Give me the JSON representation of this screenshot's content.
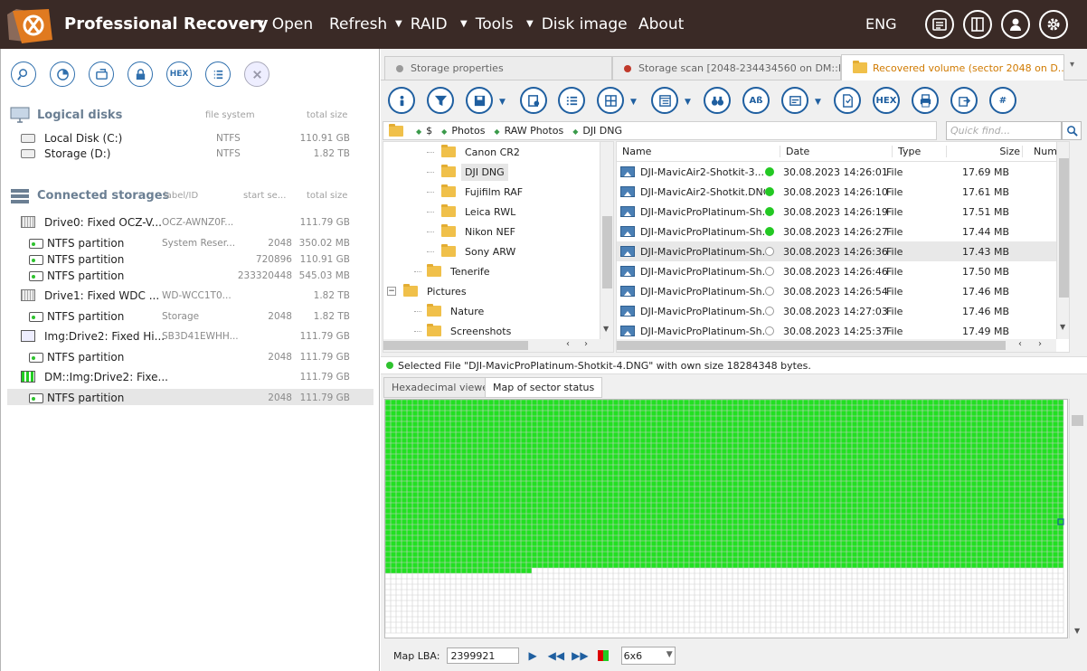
{
  "app": {
    "title": "Professional Recovery",
    "lang": "ENG"
  },
  "menu": [
    {
      "label": "Open",
      "dropdown": true
    },
    {
      "label": "Refresh",
      "dropdown": false
    },
    {
      "label": "RAID",
      "dropdown": true
    },
    {
      "label": "Tools",
      "dropdown": true
    },
    {
      "label": "Disk image",
      "dropdown": true
    },
    {
      "label": "About",
      "dropdown": false
    }
  ],
  "left_toolbar": {
    "hex_label": "HEX"
  },
  "logical": {
    "title": "Logical disks",
    "col_fs": "file system",
    "col_size": "total size",
    "items": [
      {
        "name": "Local Disk (C:)",
        "fs": "NTFS",
        "size": "110.91 GB"
      },
      {
        "name": "Storage (D:)",
        "fs": "NTFS",
        "size": "1.82 TB"
      }
    ]
  },
  "connected": {
    "title": "Connected storages",
    "col_label": "label/ID",
    "col_start": "start se...",
    "col_size": "total size",
    "items": [
      {
        "name": "Drive0: Fixed OCZ-V...",
        "label": "OCZ-AWNZ0F...",
        "start": "",
        "size": "111.79 GB",
        "kind": "drive"
      },
      {
        "name": "NTFS partition",
        "label": "System Reser...",
        "start": "2048",
        "size": "350.02 MB",
        "kind": "part"
      },
      {
        "name": "NTFS partition",
        "label": "",
        "start": "720896",
        "size": "110.91 GB",
        "kind": "part"
      },
      {
        "name": "NTFS partition",
        "label": "",
        "start": "233320448",
        "size": "545.03 MB",
        "kind": "part"
      },
      {
        "name": "Drive1: Fixed WDC ...",
        "label": "WD-WCC1T0...",
        "start": "",
        "size": "1.82 TB",
        "kind": "drive"
      },
      {
        "name": "NTFS partition",
        "label": "Storage",
        "start": "2048",
        "size": "1.82 TB",
        "kind": "part"
      },
      {
        "name": "Img:Drive2: Fixed Hi...",
        "label": "SB3D41EWHH...",
        "start": "",
        "size": "111.79 GB",
        "kind": "img"
      },
      {
        "name": "NTFS partition",
        "label": "",
        "start": "2048",
        "size": "111.79 GB",
        "kind": "part"
      },
      {
        "name": "DM::Img:Drive2: Fixe...",
        "label": "",
        "start": "",
        "size": "111.79 GB",
        "kind": "dm"
      },
      {
        "name": "NTFS partition",
        "label": "",
        "start": "2048",
        "size": "111.79 GB",
        "kind": "part",
        "selected": true
      }
    ]
  },
  "tabs": [
    {
      "label": "Storage properties",
      "dot": "#9a9a9a"
    },
    {
      "label": "Storage scan [2048-234434560 on DM::Im...",
      "dot": "#c0392b"
    },
    {
      "label": "Recovered volume (sector 2048 on D...",
      "dot": "folder",
      "active": true
    }
  ],
  "toolbar2": {
    "hex_label": "HEX",
    "ab_label": "Aß",
    "hash_label": "#"
  },
  "path": [
    "$",
    "Photos",
    "RAW Photos",
    "DJI DNG"
  ],
  "quickfind_placeholder": "Quick find...",
  "tree": [
    {
      "label": "Canon CR2",
      "indent": 2
    },
    {
      "label": "DJI DNG",
      "indent": 2,
      "selected": true
    },
    {
      "label": "Fujifilm RAF",
      "indent": 2
    },
    {
      "label": "Leica RWL",
      "indent": 2
    },
    {
      "label": "Nikon NEF",
      "indent": 2
    },
    {
      "label": "Sony ARW",
      "indent": 2
    },
    {
      "label": "Tenerife",
      "indent": 1
    },
    {
      "label": "Pictures",
      "indent": 0,
      "expander": "−"
    },
    {
      "label": "Nature",
      "indent": 1
    },
    {
      "label": "Screenshots",
      "indent": 1
    }
  ],
  "file_columns": {
    "name": "Name",
    "date": "Date",
    "type": "Type",
    "size": "Size",
    "num": "Num"
  },
  "files": [
    {
      "name": "DJI-MavicAir2-Shotkit-3....",
      "status": "green",
      "date": "30.08.2023 14:26:01",
      "type": "File",
      "size": "17.69 MB"
    },
    {
      "name": "DJI-MavicAir2-Shotkit.DNG",
      "status": "green",
      "date": "30.08.2023 14:26:10",
      "type": "File",
      "size": "17.61 MB"
    },
    {
      "name": "DJI-MavicProPlatinum-Sh...",
      "status": "green",
      "date": "30.08.2023 14:26:19",
      "type": "File",
      "size": "17.51 MB"
    },
    {
      "name": "DJI-MavicProPlatinum-Sh...",
      "status": "green",
      "date": "30.08.2023 14:26:27",
      "type": "File",
      "size": "17.44 MB"
    },
    {
      "name": "DJI-MavicProPlatinum-Sh...",
      "status": "empty",
      "date": "30.08.2023 14:26:36",
      "type": "File",
      "size": "17.43 MB",
      "selected": true
    },
    {
      "name": "DJI-MavicProPlatinum-Sh...",
      "status": "empty",
      "date": "30.08.2023 14:26:46",
      "type": "File",
      "size": "17.50 MB"
    },
    {
      "name": "DJI-MavicProPlatinum-Sh...",
      "status": "empty",
      "date": "30.08.2023 14:26:54",
      "type": "File",
      "size": "17.46 MB"
    },
    {
      "name": "DJI-MavicProPlatinum-Sh...",
      "status": "empty",
      "date": "30.08.2023 14:27:03",
      "type": "File",
      "size": "17.46 MB"
    },
    {
      "name": "DJI-MavicProPlatinum-Sh...",
      "status": "empty",
      "date": "30.08.2023 14:25:37",
      "type": "File",
      "size": "17.49 MB"
    }
  ],
  "status_text": "Selected File \"DJI-MavicProPlatinum-Shotkit-4.DNG\" with own size 18284348 bytes.",
  "bottom_tabs": [
    "Hexadecimal viewer",
    "Map of sector status"
  ],
  "map": {
    "lba_label": "Map LBA:",
    "lba_value": "2399921",
    "cell_size": "6x6",
    "fill_color": "#22e022",
    "filled_fraction": 0.726
  },
  "colors": {
    "titlebar": "#3a2a26",
    "accent": "#2f6fad",
    "ok": "#22c822"
  }
}
